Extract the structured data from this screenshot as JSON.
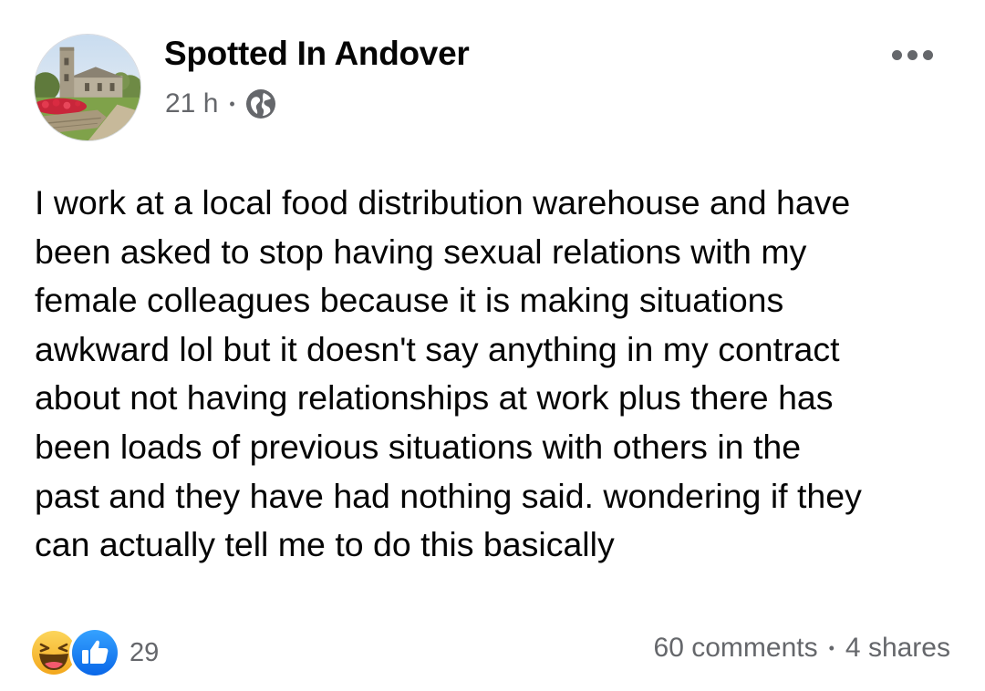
{
  "post": {
    "page_name": "Spotted In Andover",
    "time_ago": "21 h",
    "separator": "•",
    "audience_icon": "globe-icon",
    "more_icon": "more-options-icon",
    "text": "I work at a local food distribution warehouse and have\nbeen asked to stop having sexual relations with my\nfemale colleagues because it is making situations\nawkward lol but it doesn't say anything in my contract\nabout not having relationships at work plus there has\nbeen loads of previous situations with others in the\npast and they have had nothing said. wondering if they\ncan actually tell me to do this basically"
  },
  "reactions": {
    "icons": [
      "haha-reaction-icon",
      "like-reaction-icon"
    ],
    "count": "29"
  },
  "engagement": {
    "comments": "60 comments",
    "separator": "•",
    "shares": "4 shares"
  },
  "colors": {
    "text_primary": "#050505",
    "text_secondary": "#65676b",
    "like_blue": "#1877f2",
    "haha_yellow": "#f7b125"
  }
}
